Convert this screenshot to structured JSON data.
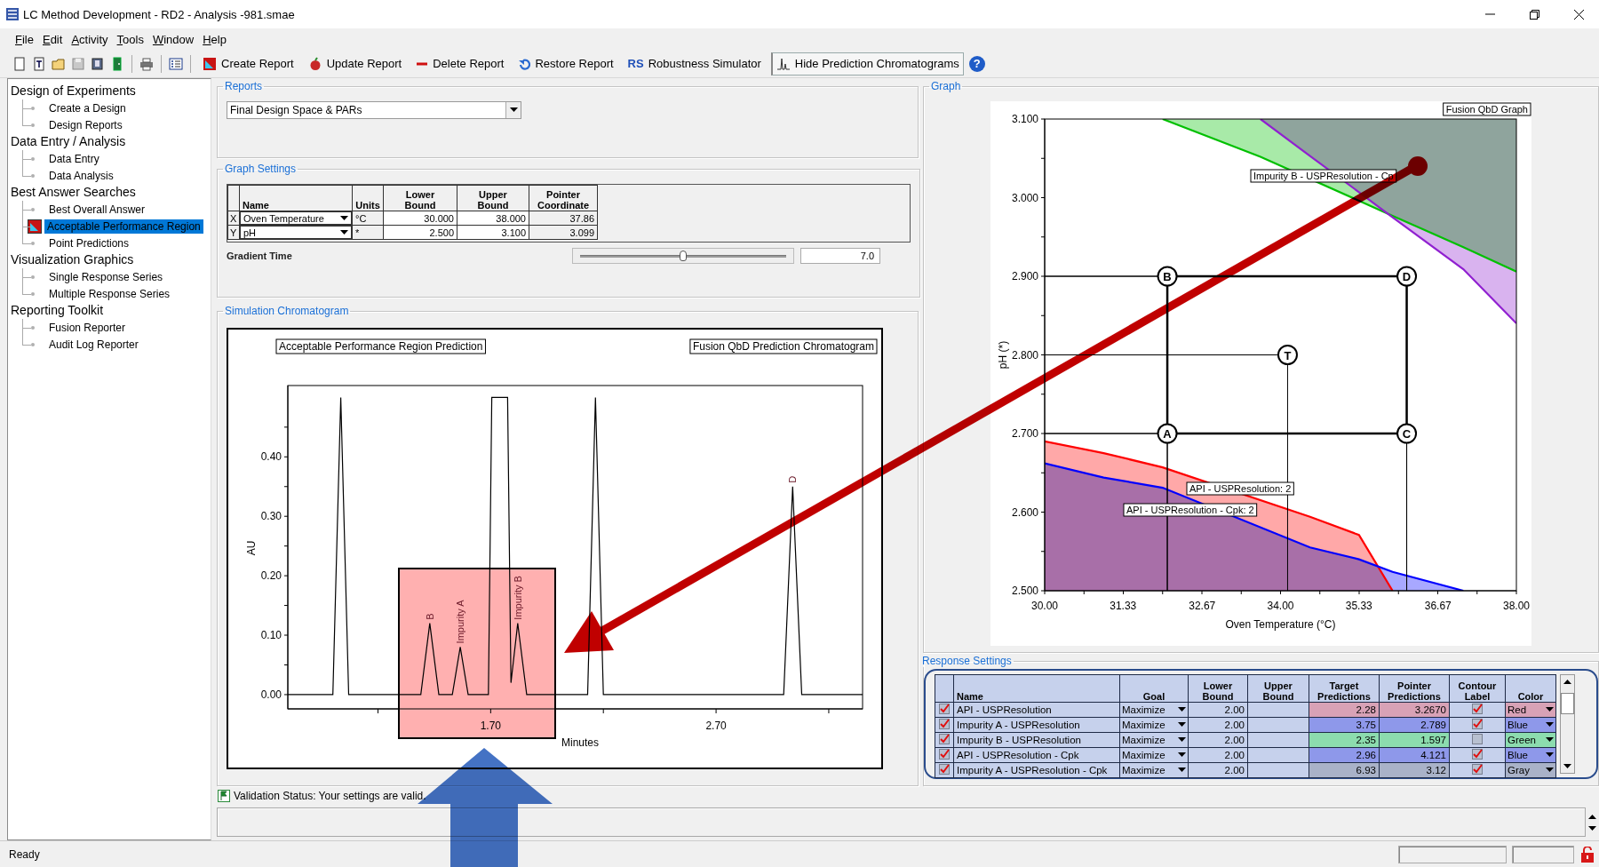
{
  "window": {
    "title": "LC Method Development - RD2 - Analysis -981.smae"
  },
  "menu": [
    "File",
    "Edit",
    "Activity",
    "Tools",
    "Window",
    "Help"
  ],
  "toolbar": {
    "buttons": [
      {
        "kind": "create",
        "label": "Create Report",
        "pressed": false
      },
      {
        "kind": "update",
        "label": "Update Report",
        "pressed": false
      },
      {
        "kind": "delete",
        "label": "Delete Report",
        "pressed": false
      },
      {
        "kind": "restore",
        "label": "Restore Report",
        "pressed": false
      },
      {
        "kind": "robustness",
        "badge": "RS",
        "label": "Robustness Simulator",
        "pressed": false
      },
      {
        "kind": "chromatogram",
        "label": "Hide Prediction Chromatograms",
        "pressed": true
      }
    ],
    "help": "?"
  },
  "sidebar": {
    "items": [
      {
        "label": "Design of Experiments",
        "selected": false,
        "children": [
          {
            "label": "Create a Design",
            "selected": false
          },
          {
            "label": "Design Reports",
            "selected": false
          }
        ]
      },
      {
        "label": "Data Entry / Analysis",
        "selected": false,
        "children": [
          {
            "label": "Data Entry",
            "selected": false
          },
          {
            "label": "Data Analysis",
            "selected": false
          }
        ]
      },
      {
        "label": "Best Answer Searches",
        "selected": false,
        "children": [
          {
            "label": "Best Overall Answer",
            "selected": false
          },
          {
            "label": "Acceptable Performance Region",
            "selected": true
          },
          {
            "label": "Point Predictions",
            "selected": false
          }
        ]
      },
      {
        "label": "Visualization Graphics",
        "selected": false,
        "children": [
          {
            "label": "Single Response Series",
            "selected": false
          },
          {
            "label": "Multiple Response Series",
            "selected": false
          }
        ]
      },
      {
        "label": "Reporting Toolkit",
        "selected": false,
        "children": [
          {
            "label": "Fusion Reporter",
            "selected": false
          },
          {
            "label": "Audit Log Reporter",
            "selected": false
          }
        ]
      }
    ]
  },
  "reports": {
    "label": "Reports",
    "report": "Final Design Space & PARs"
  },
  "graph_settings": {
    "label": "Graph Settings",
    "columns": [
      "Name",
      "Units",
      "Lower Bound",
      "Upper Bound",
      "Pointer Coordinate"
    ],
    "rows": [
      {
        "axis": "X",
        "name": "Oven Temperature",
        "units": "°C",
        "lower": "30.000",
        "upper": "38.000",
        "pointer": "37.86"
      },
      {
        "axis": "Y",
        "name": "pH",
        "units": "*",
        "lower": "2.500",
        "upper": "3.100",
        "pointer": "3.099"
      }
    ],
    "gradient": {
      "label": "Gradient Time",
      "level": 0.5,
      "value": "7.0"
    }
  },
  "chromatogram": {
    "label": "Simulation Chromatogram",
    "caption_left": "Acceptable Performance Region Prediction",
    "caption_right": "Fusion QbD Prediction Chromatogram",
    "chart_data": {
      "type": "line",
      "xlabel": "Minutes",
      "ylabel": "AU",
      "x": [
        0.8,
        1.0,
        1.035,
        1.07,
        1.39,
        1.43,
        1.47,
        1.53,
        1.565,
        1.6,
        1.69,
        1.705,
        1.74,
        1.775,
        1.79,
        1.82,
        1.86,
        2.13,
        2.165,
        2.2,
        3.0,
        3.04,
        3.08,
        3.35
      ],
      "series": [
        {
          "color": "#000000",
          "values": [
            0,
            0,
            0.5,
            0,
            0,
            0.12,
            0,
            0,
            0.08,
            0,
            0,
            0.5,
            0.5,
            0.5,
            0.02,
            0.12,
            0,
            0,
            0.5,
            0,
            0,
            0.35,
            0,
            0
          ]
        }
      ],
      "xlim": [
        0.8,
        3.35
      ],
      "ylim": [
        -0.024,
        0.52
      ],
      "xticks": [
        {
          "value": 1.7,
          "label": "1.70"
        },
        {
          "value": 2.7,
          "label": "2.70"
        }
      ],
      "yticks": [
        {
          "value": 0,
          "label": "0.00"
        },
        {
          "value": 0.1,
          "label": "0.10"
        },
        {
          "value": 0.2,
          "label": "0.20"
        },
        {
          "value": 0.3,
          "label": "0.30"
        },
        {
          "value": 0.4,
          "label": "0.40"
        }
      ],
      "annotations": [
        {
          "x": 1.43,
          "y": 0.12,
          "text": "B"
        },
        {
          "x": 1.565,
          "y": 0.08,
          "text": "Impurity A"
        },
        {
          "x": 1.82,
          "y": 0.12,
          "text": "Impurity B"
        },
        {
          "x": 3.04,
          "y": 0.35,
          "text": "D"
        }
      ]
    }
  },
  "validation": {
    "text": "Validation Status: Your settings are valid."
  },
  "graph": {
    "label": "Graph",
    "caption": "Fusion QbD Graph",
    "chart_data": {
      "type": "line",
      "xlabel": "Oven Temperature (°C)",
      "ylabel": "pH (*)",
      "grid": true,
      "x": [
        30,
        31.0,
        32.0,
        33.66,
        34.5,
        35.33,
        35.9,
        37.1,
        38
      ],
      "series": [
        {
          "color": "#ff0000",
          "values": [
            2.69,
            2.675,
            2.657,
            null,
            2.594,
            2.571,
            2.5,
            null,
            null
          ]
        },
        {
          "color": "#0000ff",
          "values": [
            2.662,
            2.644,
            2.631,
            null,
            2.555,
            2.54,
            2.524,
            2.5,
            null
          ]
        },
        {
          "color": "#00c000",
          "values": [
            null,
            null,
            3.1,
            3.052,
            null,
            2.996,
            2.977,
            2.937,
            2.906
          ]
        },
        {
          "color": "#9020d0",
          "values": [
            null,
            null,
            null,
            3.1,
            3.053,
            3.007,
            2.975,
            2.909,
            2.84
          ]
        }
      ],
      "xlim": [
        30,
        38
      ],
      "ylim": [
        2.5,
        3.1
      ],
      "xticks": [
        {
          "value": 30,
          "label": "30.00"
        },
        {
          "value": 31.33,
          "label": "31.33"
        },
        {
          "value": 32.67,
          "label": "32.67"
        },
        {
          "value": 34,
          "label": "34.00"
        },
        {
          "value": 35.33,
          "label": "35.33"
        },
        {
          "value": 36.67,
          "label": "36.67"
        },
        {
          "value": 38,
          "label": "38.00"
        }
      ],
      "yticks": [
        {
          "value": 2.5,
          "label": "2.500"
        },
        {
          "value": 2.6,
          "label": "2.600"
        },
        {
          "value": 2.7,
          "label": "2.700"
        },
        {
          "value": 2.8,
          "label": "2.800"
        },
        {
          "value": 2.9,
          "label": "2.900"
        },
        {
          "value": 3.0,
          "label": "3.000"
        },
        {
          "value": 3.1,
          "label": "3.100"
        }
      ],
      "annotations": [
        {
          "x": 32.08,
          "y": 2.9,
          "text": "B"
        },
        {
          "x": 36.14,
          "y": 2.9,
          "text": "D"
        },
        {
          "x": 34.12,
          "y": 2.8,
          "text": "T"
        },
        {
          "x": 32.08,
          "y": 2.7,
          "text": "A"
        },
        {
          "x": 36.14,
          "y": 2.7,
          "text": "C"
        },
        "Impurity B - USPResolution - Cp",
        "API - USPResolution: 2",
        "API - USPResolution - Cpk: 2"
      ]
    }
  },
  "response_settings": {
    "label": "Response Settings",
    "columns": [
      "Name",
      "Goal",
      "Lower Bound",
      "Upper Bound",
      "Target Predictions",
      "Pointer Predictions",
      "Contour Label",
      "Color"
    ],
    "rows": [
      {
        "enabled": true,
        "name": "API - USPResolution",
        "goal": "Maximize",
        "lower": "2.00",
        "target": "2.28",
        "pointer": "3.2670",
        "contour_label": true,
        "color_name": "Red",
        "color": "#d8a2b6"
      },
      {
        "enabled": true,
        "name": "Impurity A - USPResolution",
        "goal": "Maximize",
        "lower": "2.00",
        "target": "3.75",
        "pointer": "2.789",
        "contour_label": true,
        "color_name": "Blue",
        "color": "#8e98ea"
      },
      {
        "enabled": true,
        "name": "Impurity B - USPResolution",
        "goal": "Maximize",
        "lower": "2.00",
        "target": "2.35",
        "pointer": "1.597",
        "contour_label": false,
        "color_name": "Green",
        "color": "#8cdcae"
      },
      {
        "enabled": true,
        "name": "API - USPResolution - Cpk",
        "goal": "Maximize",
        "lower": "2.00",
        "target": "2.96",
        "pointer": "4.121",
        "contour_label": true,
        "color_name": "Blue",
        "color": "#8e98ea"
      },
      {
        "enabled": true,
        "name": "Impurity A - USPResolution - Cpk",
        "goal": "Maximize",
        "lower": "2.00",
        "target": "6.93",
        "pointer": "3.12",
        "contour_label": true,
        "color_name": "Gray",
        "color": "#a9b2c8"
      }
    ]
  },
  "status_bar": {
    "text": "Ready"
  }
}
